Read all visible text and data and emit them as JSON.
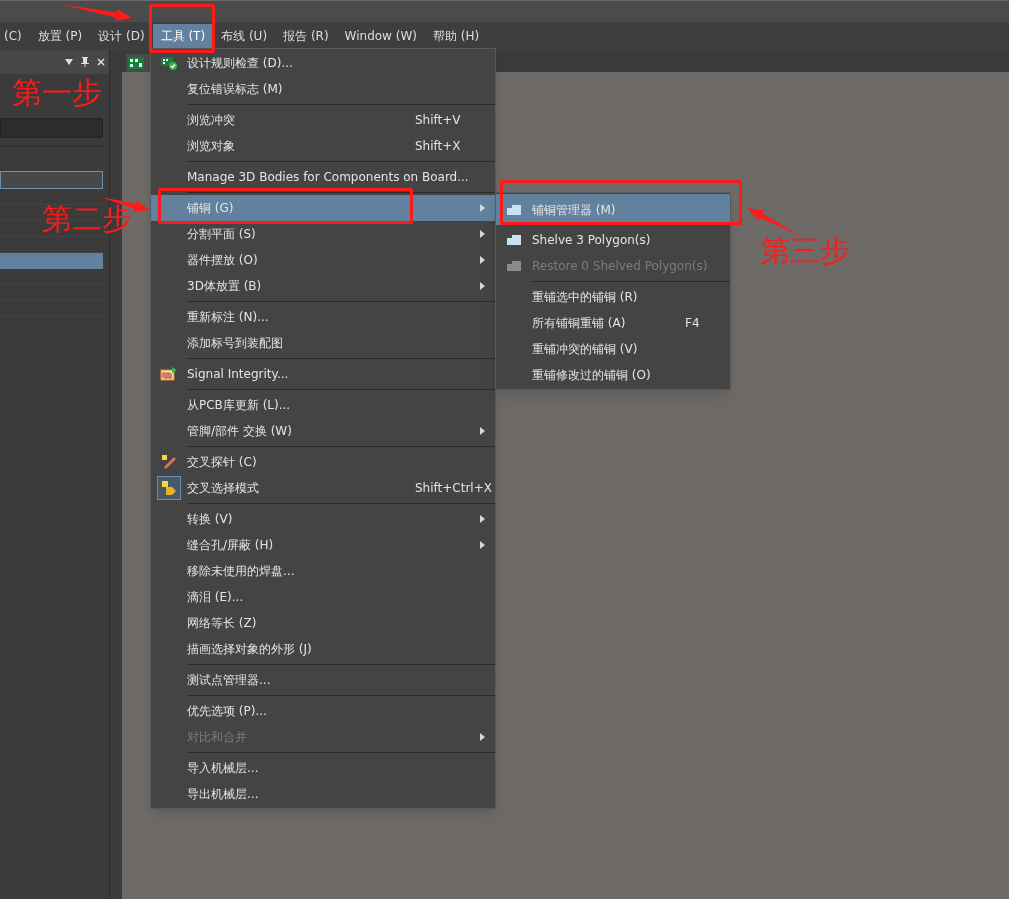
{
  "menubar": [
    {
      "label": "(C)",
      "selected": false
    },
    {
      "label": "放置 (P)",
      "selected": false
    },
    {
      "label": "设计 (D)",
      "selected": false
    },
    {
      "label": "工具 (T)",
      "selected": true
    },
    {
      "label": "布线 (U)",
      "selected": false
    },
    {
      "label": "报告 (R)",
      "selected": false
    },
    {
      "label": "Window (W)",
      "selected": false
    },
    {
      "label": "帮助 (H)",
      "selected": false
    }
  ],
  "tools_menu": [
    {
      "kind": "item",
      "label": "设计规则检查 (D)...",
      "selected": false,
      "disabled": false,
      "submenu": false,
      "checked": false
    },
    {
      "kind": "item",
      "label": "复位错误标志 (M)",
      "selected": false,
      "disabled": false,
      "submenu": false,
      "checked": false
    },
    {
      "kind": "separator"
    },
    {
      "kind": "item",
      "label": "浏览冲突",
      "shortcut": "Shift+V",
      "selected": false,
      "disabled": false,
      "submenu": false,
      "checked": false
    },
    {
      "kind": "item",
      "label": "浏览对象",
      "shortcut": "Shift+X",
      "selected": false,
      "disabled": false,
      "submenu": false,
      "checked": false
    },
    {
      "kind": "separator"
    },
    {
      "kind": "item",
      "label": "Manage 3D Bodies for Components on Board...",
      "selected": false,
      "disabled": false,
      "submenu": false,
      "checked": false
    },
    {
      "kind": "separator"
    },
    {
      "kind": "item",
      "label": "铺铜 (G)",
      "selected": true,
      "disabled": false,
      "submenu": true,
      "checked": false
    },
    {
      "kind": "item",
      "label": "分割平面 (S)",
      "selected": false,
      "disabled": false,
      "submenu": true,
      "checked": false
    },
    {
      "kind": "item",
      "label": "器件摆放 (O)",
      "selected": false,
      "disabled": false,
      "submenu": true,
      "checked": false
    },
    {
      "kind": "item",
      "label": "3D体放置 (B)",
      "selected": false,
      "disabled": false,
      "submenu": true,
      "checked": false
    },
    {
      "kind": "separator"
    },
    {
      "kind": "item",
      "label": "重新标注 (N)...",
      "selected": false,
      "disabled": false,
      "submenu": false,
      "checked": false
    },
    {
      "kind": "item",
      "label": "添加标号到装配图",
      "selected": false,
      "disabled": false,
      "submenu": false,
      "checked": false
    },
    {
      "kind": "separator"
    },
    {
      "kind": "item",
      "label": "Signal Integrity...",
      "selected": false,
      "disabled": false,
      "submenu": false,
      "checked": false
    },
    {
      "kind": "separator"
    },
    {
      "kind": "item",
      "label": "从PCB库更新 (L)...",
      "selected": false,
      "disabled": false,
      "submenu": false,
      "checked": false
    },
    {
      "kind": "item",
      "label": "管脚/部件 交换 (W)",
      "selected": false,
      "disabled": false,
      "submenu": true,
      "checked": false
    },
    {
      "kind": "separator"
    },
    {
      "kind": "item",
      "label": "交叉探针 (C)",
      "selected": false,
      "disabled": false,
      "submenu": false,
      "checked": false
    },
    {
      "kind": "item",
      "label": "交叉选择模式",
      "shortcut": "Shift+Ctrl+X",
      "selected": false,
      "disabled": false,
      "submenu": false,
      "checked": true
    },
    {
      "kind": "separator"
    },
    {
      "kind": "item",
      "label": "转换 (V)",
      "selected": false,
      "disabled": false,
      "submenu": true,
      "checked": false
    },
    {
      "kind": "item",
      "label": "缝合孔/屏蔽 (H)",
      "selected": false,
      "disabled": false,
      "submenu": true,
      "checked": false
    },
    {
      "kind": "item",
      "label": "移除未使用的焊盘...",
      "selected": false,
      "disabled": false,
      "submenu": false,
      "checked": false
    },
    {
      "kind": "item",
      "label": "滴泪 (E)...",
      "selected": false,
      "disabled": false,
      "submenu": false,
      "checked": false
    },
    {
      "kind": "item",
      "label": "网络等长 (Z)",
      "selected": false,
      "disabled": false,
      "submenu": false,
      "checked": false
    },
    {
      "kind": "item",
      "label": "描画选择对象的外形 (J)",
      "selected": false,
      "disabled": false,
      "submenu": false,
      "checked": false
    },
    {
      "kind": "separator"
    },
    {
      "kind": "item",
      "label": "测试点管理器...",
      "selected": false,
      "disabled": false,
      "submenu": false,
      "checked": false
    },
    {
      "kind": "separator"
    },
    {
      "kind": "item",
      "label": "优先选项 (P)...",
      "selected": false,
      "disabled": false,
      "submenu": false,
      "checked": false
    },
    {
      "kind": "item",
      "label": "对比和合并",
      "selected": false,
      "disabled": true,
      "submenu": true,
      "checked": false
    },
    {
      "kind": "separator"
    },
    {
      "kind": "item",
      "label": "导入机械层...",
      "selected": false,
      "disabled": false,
      "submenu": false,
      "checked": false
    },
    {
      "kind": "item",
      "label": "导出机械层...",
      "selected": false,
      "disabled": false,
      "submenu": false,
      "checked": false
    }
  ],
  "polygon_submenu": [
    {
      "kind": "item",
      "label": "铺铜管理器 (M)",
      "selected": true,
      "disabled": false
    },
    {
      "kind": "item",
      "label": "Shelve 3 Polygon(s)",
      "selected": false,
      "disabled": false
    },
    {
      "kind": "item",
      "label": "Restore 0 Shelved Polygon(s)",
      "selected": false,
      "disabled": true
    },
    {
      "kind": "separator"
    },
    {
      "kind": "item",
      "label": "重铺选中的铺铜 (R)",
      "selected": false,
      "disabled": false
    },
    {
      "kind": "item",
      "label": "所有铺铜重铺 (A)",
      "shortcut": "F4",
      "selected": false,
      "disabled": false
    },
    {
      "kind": "item",
      "label": "重铺冲突的铺铜 (V)",
      "selected": false,
      "disabled": false
    },
    {
      "kind": "item",
      "label": "重铺修改过的铺铜 (O)",
      "selected": false,
      "disabled": false
    }
  ],
  "annotations": [
    {
      "text": "第一步"
    },
    {
      "text": "第二步"
    },
    {
      "text": "第三步"
    }
  ]
}
